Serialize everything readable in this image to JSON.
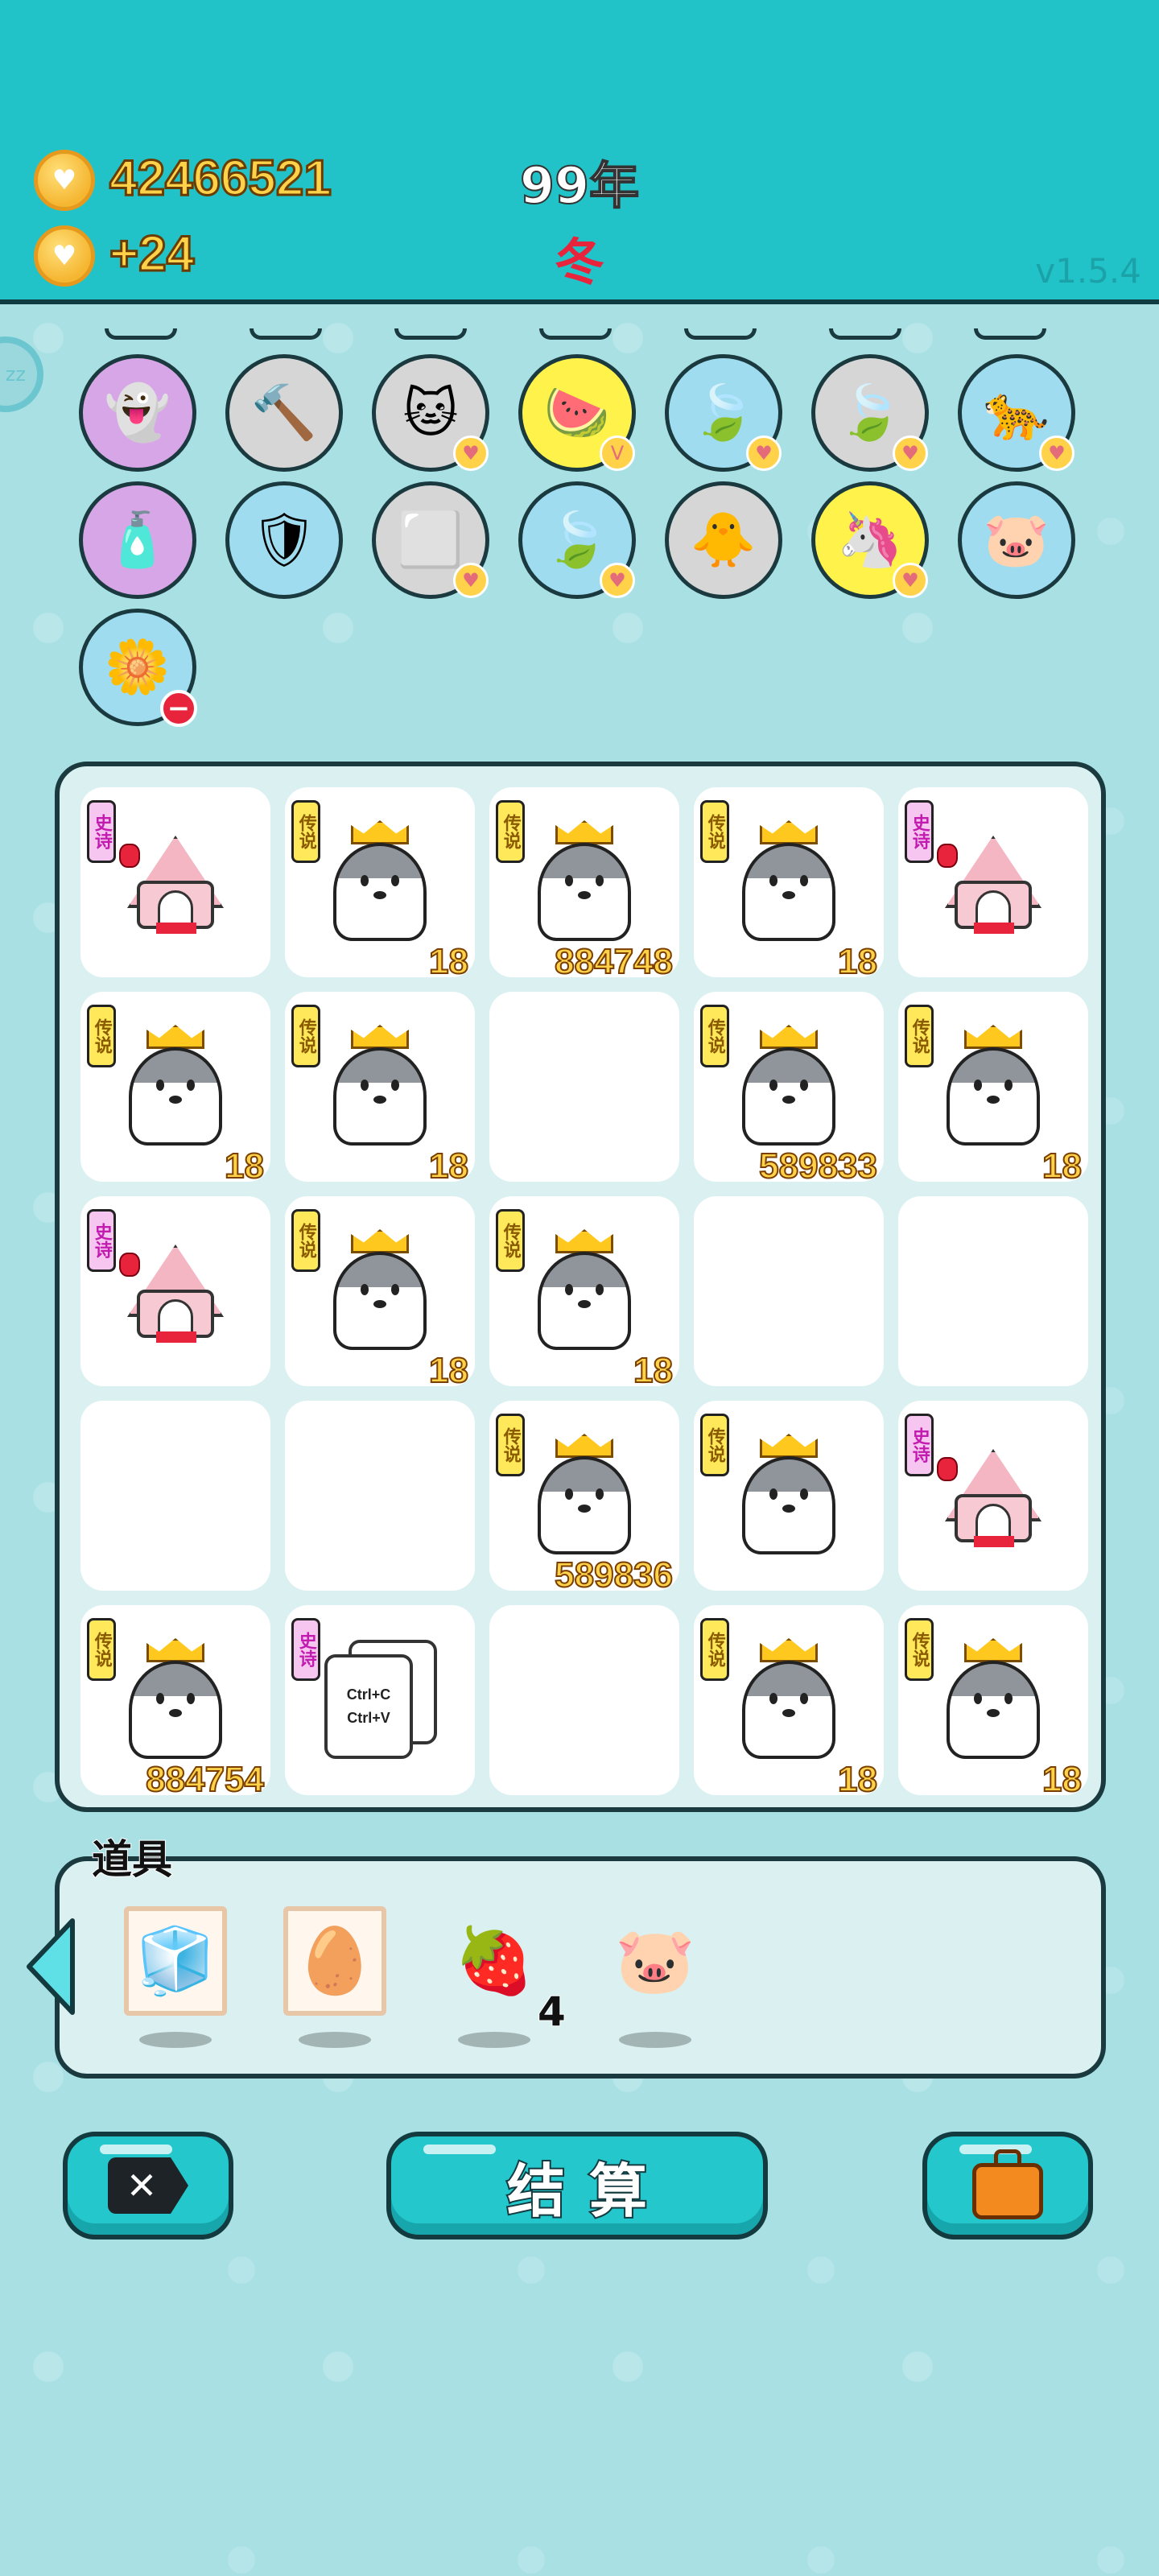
{
  "header": {
    "coins": "42466521",
    "income": "+24",
    "year": "99年",
    "season": "冬",
    "version": "v1.5.4",
    "side_button": "zz"
  },
  "skills": [
    {
      "name": "ghost-egg-skill",
      "glyph": "👻",
      "bg": "#d7a6e6",
      "badge": ""
    },
    {
      "name": "hammer-skill",
      "glyph": "🔨",
      "bg": "#d6d6d6",
      "badge": ""
    },
    {
      "name": "twin-cats-skill",
      "glyph": "🐱",
      "bg": "#d6d6d6",
      "badge": "♥"
    },
    {
      "name": "fruit-basket-skill",
      "glyph": "🍉",
      "bg": "#fff24a",
      "badge": "V"
    },
    {
      "name": "leaf-skill-1",
      "glyph": "🍃",
      "bg": "#9fdcef",
      "badge": "♥"
    },
    {
      "name": "leaf-skill-2",
      "glyph": "🍃",
      "bg": "#d6d6d6",
      "badge": "♥"
    },
    {
      "name": "cat-skill",
      "glyph": "🐆",
      "bg": "#9fdcef",
      "badge": "♥"
    },
    {
      "name": "spray-bottle-skill",
      "glyph": "🧴",
      "bg": "#d7a6e6",
      "badge": ""
    },
    {
      "name": "shield-wrench-skill",
      "glyph": "🛡",
      "bg": "#9fdcef",
      "badge": ""
    },
    {
      "name": "sugar-cubes-skill",
      "glyph": "⬜",
      "bg": "#d6d6d6",
      "badge": "♥"
    },
    {
      "name": "leaf-skill-3",
      "glyph": "🍃",
      "bg": "#9fdcef",
      "badge": "♥"
    },
    {
      "name": "chick-egg-skill",
      "glyph": "🐥",
      "bg": "#d6d6d6",
      "badge": ""
    },
    {
      "name": "unicorn-skill",
      "glyph": "🦄",
      "bg": "#fff24a",
      "badge": "♥"
    },
    {
      "name": "piggy-skill",
      "glyph": "🐷",
      "bg": "#9fdcef",
      "badge": ""
    },
    {
      "name": "flower-pot-skill",
      "glyph": "🌼",
      "bg": "#9fdcef",
      "badge": "-"
    }
  ],
  "labels": {
    "legend": "传说",
    "epic": "史诗"
  },
  "board": [
    {
      "type": "hut",
      "tag": "史诗",
      "num": ""
    },
    {
      "type": "husky",
      "tag": "传说",
      "num": "18"
    },
    {
      "type": "husky",
      "tag": "传说",
      "num": "884748"
    },
    {
      "type": "husky",
      "tag": "传说",
      "num": "18"
    },
    {
      "type": "hut",
      "tag": "史诗",
      "num": ""
    },
    {
      "type": "husky",
      "tag": "传说",
      "num": "18"
    },
    {
      "type": "husky",
      "tag": "传说",
      "num": "18"
    },
    {
      "type": "empty",
      "tag": "",
      "num": ""
    },
    {
      "type": "husky",
      "tag": "传说",
      "num": "589833"
    },
    {
      "type": "husky",
      "tag": "传说",
      "num": "18"
    },
    {
      "type": "hut",
      "tag": "史诗",
      "num": ""
    },
    {
      "type": "husky",
      "tag": "传说",
      "num": "18"
    },
    {
      "type": "husky",
      "tag": "传说",
      "num": "18"
    },
    {
      "type": "empty",
      "tag": "",
      "num": ""
    },
    {
      "type": "empty",
      "tag": "",
      "num": ""
    },
    {
      "type": "empty",
      "tag": "",
      "num": ""
    },
    {
      "type": "empty",
      "tag": "",
      "num": ""
    },
    {
      "type": "husky",
      "tag": "传说",
      "num": "589836"
    },
    {
      "type": "husky",
      "tag": "传说",
      "num": ""
    },
    {
      "type": "hut",
      "tag": "史诗",
      "num": ""
    },
    {
      "type": "husky",
      "tag": "传说",
      "num": "884754"
    },
    {
      "type": "clip",
      "tag": "史诗",
      "num": ""
    },
    {
      "type": "empty",
      "tag": "",
      "num": ""
    },
    {
      "type": "husky",
      "tag": "传说",
      "num": "18"
    },
    {
      "type": "husky",
      "tag": "传说",
      "num": "18"
    }
  ],
  "clip_card": {
    "line1": "Ctrl+C",
    "line2": "Ctrl+V"
  },
  "props": {
    "title": "道具",
    "items": [
      {
        "name": "fridge-item",
        "glyph": "🧊",
        "framed": true,
        "count": ""
      },
      {
        "name": "egg-item",
        "glyph": "🥚",
        "framed": true,
        "count": ""
      },
      {
        "name": "lychee-item",
        "glyph": "🍓",
        "framed": false,
        "count": "4"
      },
      {
        "name": "piggy-bank-item",
        "glyph": "🐷",
        "framed": false,
        "count": ""
      }
    ]
  },
  "buttons": {
    "cancel_icon": "✕",
    "settle_label": "结算",
    "bag_icon": "💼"
  },
  "colors": {
    "header_bg": "#21c3c8",
    "accent_gold": "#ffd24a",
    "button_teal": "#23c7cc",
    "legend_tag": "#ffe85a",
    "epic_tag": "#f6c6f0"
  }
}
